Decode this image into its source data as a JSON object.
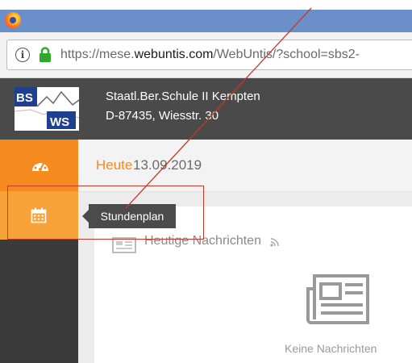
{
  "browser": {
    "url_prefix": "https://mese.",
    "url_domain": "webuntis.com",
    "url_suffix": "/WebUntis/?school=sbs2-"
  },
  "school": {
    "name": "Staatl.Ber.Schule II Kempten",
    "address": "D-87435, Wiesstr. 30",
    "logo_text_top": "BS II",
    "logo_text_bottom": "WS"
  },
  "today": {
    "label": "Heute",
    "date": "13.09.2019"
  },
  "sidebar": {
    "items": [
      {
        "icon": "dashboard-icon",
        "active": true
      },
      {
        "icon": "calendar-icon",
        "active": false
      }
    ]
  },
  "tooltip": {
    "text": "Stundenplan"
  },
  "news": {
    "title": "Heutige Nachrichten",
    "empty_text": "Keine Nachrichten"
  },
  "colors": {
    "accent": "#f58a1f",
    "accent_light": "#f8a33a",
    "header_bg": "#4a4a4a",
    "sidebar_bg": "#3a3a3a",
    "annotation": "#c0392b"
  }
}
